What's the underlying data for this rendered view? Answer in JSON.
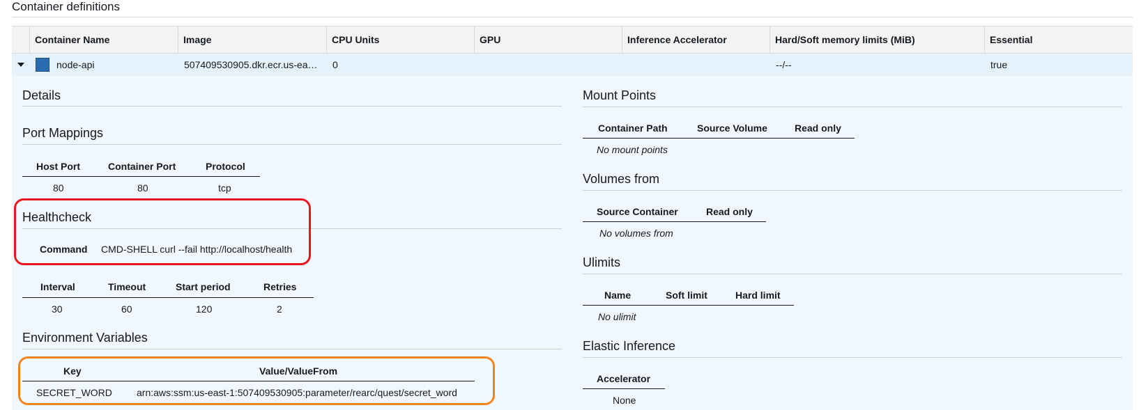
{
  "section": {
    "title": "Container definitions"
  },
  "table": {
    "headers": [
      "Container Name",
      "Image",
      "CPU Units",
      "GPU",
      "Inference Accelerator",
      "Hard/Soft memory limits (MiB)",
      "Essential"
    ],
    "row": {
      "name": "node-api",
      "image": "507409530905.dkr.ecr.us-ea…",
      "cpu": "0",
      "gpu": "",
      "inference": "",
      "memory": "--/--",
      "essential": "true"
    }
  },
  "details": {
    "title": "Details",
    "port_mappings": {
      "title": "Port Mappings",
      "headers": [
        "Host Port",
        "Container Port",
        "Protocol"
      ],
      "row": [
        "80",
        "80",
        "tcp"
      ]
    },
    "healthcheck": {
      "title": "Healthcheck",
      "command_label": "Command",
      "command_value": "CMD-SHELL curl --fail http://localhost/health",
      "headers": [
        "Interval",
        "Timeout",
        "Start period",
        "Retries"
      ],
      "row": [
        "30",
        "60",
        "120",
        "2"
      ]
    },
    "env": {
      "title": "Environment Variables",
      "headers": [
        "Key",
        "Value/ValueFrom"
      ],
      "row": [
        "SECRET_WORD",
        "arn:aws:ssm:us-east-1:507409530905:parameter/rearc/quest/secret_word"
      ]
    }
  },
  "right": {
    "mount_points": {
      "title": "Mount Points",
      "headers": [
        "Container Path",
        "Source Volume",
        "Read only"
      ],
      "empty": "No mount points"
    },
    "volumes_from": {
      "title": "Volumes from",
      "headers": [
        "Source Container",
        "Read only"
      ],
      "empty": "No volumes from"
    },
    "ulimits": {
      "title": "Ulimits",
      "headers": [
        "Name",
        "Soft limit",
        "Hard limit"
      ],
      "empty": "No ulimit"
    },
    "elastic_inference": {
      "title": "Elastic Inference",
      "headers": [
        "Accelerator"
      ],
      "row": [
        "None"
      ]
    }
  },
  "colors": {
    "row_selected": "#e5f2fb",
    "panel_bg": "#f1f8fd",
    "highlight_red": "#e8171f",
    "highlight_orange": "#f28121",
    "swatch": "#2b6cb0"
  }
}
